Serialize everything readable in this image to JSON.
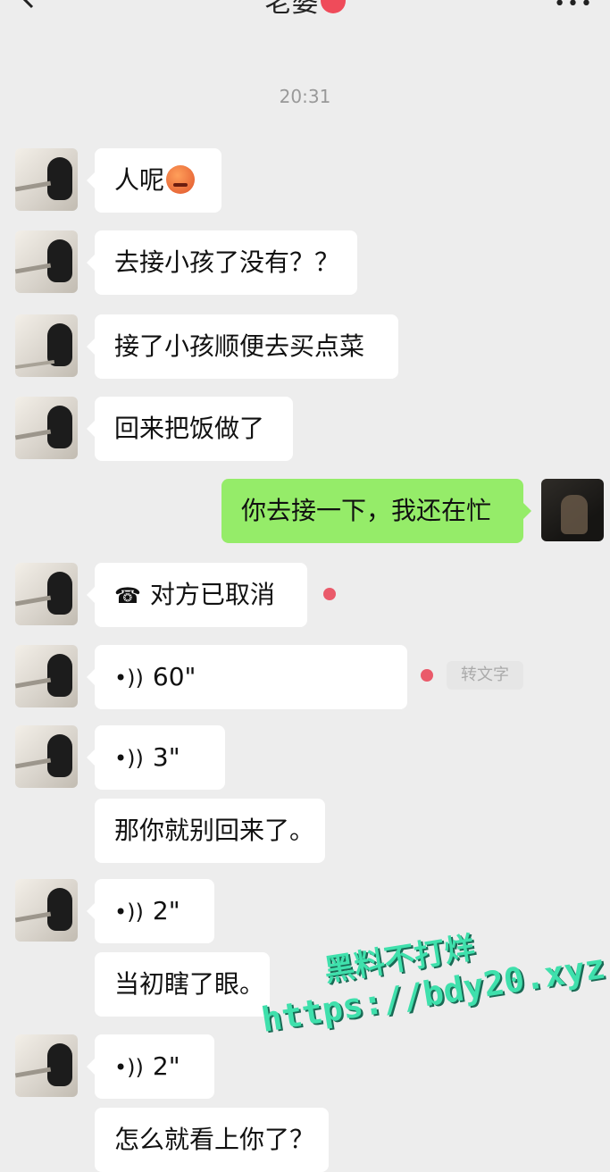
{
  "header": {
    "contact_name": "老婆",
    "more_icon": "more-dots-icon",
    "back_icon": "chevron-left-icon"
  },
  "timestamp": "20:31",
  "messages": [
    {
      "from": "her",
      "type": "text",
      "text": "人呢",
      "emoji": "angry-face-emoji"
    },
    {
      "from": "her",
      "type": "text",
      "text": "去接小孩了没有？？"
    },
    {
      "from": "her",
      "type": "text",
      "text": "接了小孩顺便去买点菜"
    },
    {
      "from": "her",
      "type": "text",
      "text": "回来把饭做了"
    },
    {
      "from": "me",
      "type": "text",
      "text": "你去接一下，我还在忙"
    },
    {
      "from": "her",
      "type": "call",
      "icon": "phone-hangup-icon",
      "text": "对方已取消"
    },
    {
      "from": "her",
      "type": "voice",
      "icon": "voice-icon",
      "duration": "60\"",
      "convert_label": "转文字"
    },
    {
      "from": "her",
      "type": "voice",
      "icon": "voice-icon",
      "duration": "3\""
    },
    {
      "from": "her",
      "type": "text",
      "text": "那你就别回来了。"
    },
    {
      "from": "her",
      "type": "voice",
      "icon": "voice-icon",
      "duration": "2\""
    },
    {
      "from": "her",
      "type": "text",
      "text": "当初瞎了眼。"
    },
    {
      "from": "her",
      "type": "voice",
      "icon": "voice-icon",
      "duration": "2\""
    },
    {
      "from": "her",
      "type": "text",
      "text": "怎么就看上你了？"
    }
  ],
  "watermark": {
    "line1": "黑料不打烊",
    "line2": "https://bdy20.xyz"
  },
  "colors": {
    "background": "#ededed",
    "my_bubble": "#95ec69",
    "their_bubble": "#ffffff",
    "unread_dot": "#ea5a6a",
    "watermark": "#3fe0ac"
  }
}
